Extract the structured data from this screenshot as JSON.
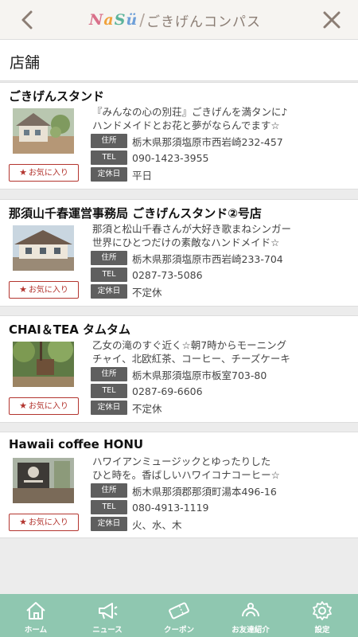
{
  "header": {
    "logo_brand": [
      "N",
      "a",
      "S",
      "ü"
    ],
    "logo_sub": "ごきげんコンパス",
    "back_icon": "chevron-left-icon",
    "close_icon": "close-icon",
    "accent_color": "#8b7d74"
  },
  "section": {
    "title": "店舗"
  },
  "labels": {
    "address": "住所",
    "tel": "TEL",
    "holiday": "定休日",
    "favorite": "お気に入り"
  },
  "shops": [
    {
      "name": "ごきげんスタンド",
      "desc1": "『みんなの心の別荘』ごきげんを満タンに♪",
      "desc2": "ハンドメイドとお花と夢がならんでます☆",
      "address": "栃木県那須塩原市西岩崎232-457",
      "tel": "090-1423-3955",
      "holiday": "平日"
    },
    {
      "name": "那須山千春運営事務局 ごきげんスタンド②号店",
      "desc1": "那須と松山千春さんが大好き歌まねシンガー",
      "desc2": "世界にひとつだけの素敵なハンドメイド☆",
      "address": "栃木県那須塩原市西岩崎233-704",
      "tel": "0287-73-5086",
      "holiday": "不定休"
    },
    {
      "name": "CHAI＆TEA タムタム",
      "desc1": "乙女の滝のすぐ近く☆朝7時からモーニング",
      "desc2": "チャイ、北欧紅茶、コーヒー、チーズケーキ",
      "address": "栃木県那須塩原市板室703-80",
      "tel": "0287-69-6606",
      "holiday": "不定休"
    },
    {
      "name": "Hawaii coffee HONU",
      "desc1": "ハワイアンミュージックとゆったりした",
      "desc2": "ひと時を。香ばしいハワイコナコーヒー☆",
      "address": "栃木県那須郡那須町湯本496-16",
      "tel": "080-4913-1119",
      "holiday": "火、水、木"
    }
  ],
  "nav": [
    {
      "label": "ホーム",
      "icon": "home-icon"
    },
    {
      "label": "ニュース",
      "icon": "megaphone-icon"
    },
    {
      "label": "クーポン",
      "icon": "coupon-icon"
    },
    {
      "label": "お友達紹介",
      "icon": "friend-referral-icon"
    },
    {
      "label": "設定",
      "icon": "gear-icon"
    }
  ],
  "colors": {
    "nav_bg": "#8fc7b0",
    "favorite": "#b3352f",
    "tag_bg": "#5f5f5f"
  }
}
